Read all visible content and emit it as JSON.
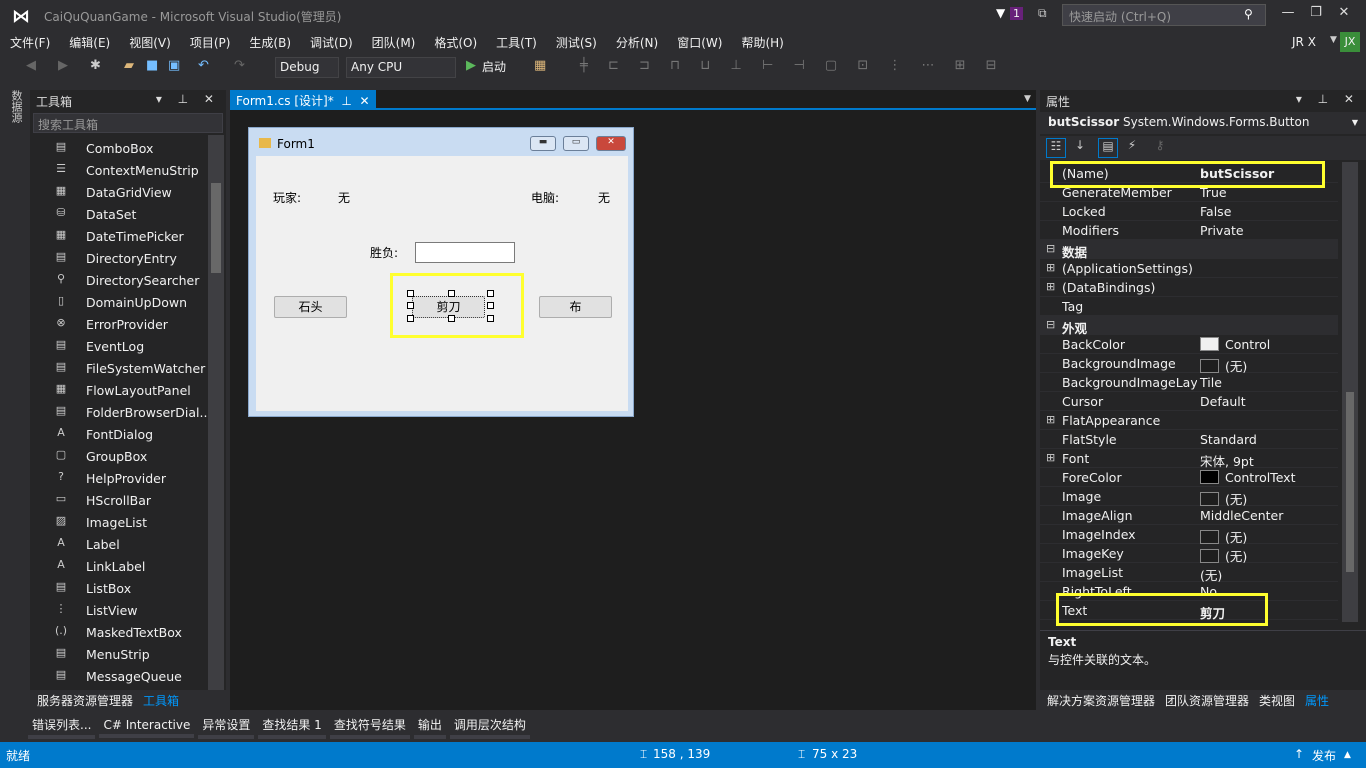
{
  "window": {
    "title": "CaiQuQuanGame - Microsoft Visual Studio(管理员)",
    "notif_count": "1",
    "quick_launch_placeholder": "快速启动 (Ctrl+Q)",
    "user": "JR X",
    "user_initials": "JX"
  },
  "menu": [
    "文件(F)",
    "编辑(E)",
    "视图(V)",
    "项目(P)",
    "生成(B)",
    "调试(D)",
    "团队(M)",
    "格式(O)",
    "工具(T)",
    "测试(S)",
    "分析(N)",
    "窗口(W)",
    "帮助(H)"
  ],
  "toolbar": {
    "config": "Debug",
    "platform": "Any CPU",
    "start": "启动"
  },
  "left_strip": "数据源",
  "toolbox": {
    "title": "工具箱",
    "search_placeholder": "搜索工具箱",
    "items": [
      "ComboBox",
      "ContextMenuStrip",
      "DataGridView",
      "DataSet",
      "DateTimePicker",
      "DirectoryEntry",
      "DirectorySearcher",
      "DomainUpDown",
      "ErrorProvider",
      "EventLog",
      "FileSystemWatcher",
      "FlowLayoutPanel",
      "FolderBrowserDial...",
      "FontDialog",
      "GroupBox",
      "HelpProvider",
      "HScrollBar",
      "ImageList",
      "Label",
      "LinkLabel",
      "ListBox",
      "ListView",
      "MaskedTextBox",
      "MenuStrip",
      "MessageQueue"
    ]
  },
  "document_tab": "Form1.cs [设计]*",
  "form": {
    "title": "Form1",
    "player_label": "玩家:",
    "player_value": "无",
    "computer_label": "电脑:",
    "computer_value": "无",
    "result_label": "胜负:",
    "result_value": "",
    "btn_rock": "石头",
    "btn_scissor": "剪刀",
    "btn_paper": "布"
  },
  "properties": {
    "title": "属性",
    "object_name": "butScissor",
    "object_type": "System.Windows.Forms.Button",
    "rows": [
      {
        "name": "(Name)",
        "value": "butScissor",
        "bold": true
      },
      {
        "name": "GenerateMember",
        "value": "True"
      },
      {
        "name": "Locked",
        "value": "False"
      },
      {
        "name": "Modifiers",
        "value": "Private"
      },
      {
        "name": "数据",
        "category": true,
        "expander": "⊟"
      },
      {
        "name": "(ApplicationSettings)",
        "value": "",
        "expander": "⊞"
      },
      {
        "name": "(DataBindings)",
        "value": "",
        "expander": "⊞"
      },
      {
        "name": "Tag",
        "value": ""
      },
      {
        "name": "外观",
        "category": true,
        "expander": "⊟"
      },
      {
        "name": "BackColor",
        "value": "Control",
        "swatch": "#f0f0f0"
      },
      {
        "name": "BackgroundImage",
        "value": "(无)",
        "swatch": "#1e1e1e"
      },
      {
        "name": "BackgroundImageLayout",
        "value": "Tile"
      },
      {
        "name": "Cursor",
        "value": "Default"
      },
      {
        "name": "FlatAppearance",
        "value": "",
        "expander": "⊞"
      },
      {
        "name": "FlatStyle",
        "value": "Standard"
      },
      {
        "name": "Font",
        "value": "宋体, 9pt",
        "expander": "⊞"
      },
      {
        "name": "ForeColor",
        "value": "ControlText",
        "swatch": "#000000"
      },
      {
        "name": "Image",
        "value": "(无)",
        "swatch": "#1e1e1e"
      },
      {
        "name": "ImageAlign",
        "value": "MiddleCenter"
      },
      {
        "name": "ImageIndex",
        "value": "(无)",
        "swatch": "#1e1e1e"
      },
      {
        "name": "ImageKey",
        "value": "(无)",
        "swatch": "#1e1e1e"
      },
      {
        "name": "ImageList",
        "value": "(无)"
      },
      {
        "name": "RightToLeft",
        "value": "No"
      },
      {
        "name": "Text",
        "value": "剪刀",
        "bold": true
      }
    ],
    "desc_title": "Text",
    "desc_text": "与控件关联的文本。"
  },
  "left_bottom_tabs": [
    "服务器资源管理器",
    "工具箱"
  ],
  "right_bottom_tabs": [
    "解决方案资源管理器",
    "团队资源管理器",
    "类视图",
    "属性"
  ],
  "output_tabs": [
    "错误列表...",
    "C# Interactive",
    "异常设置",
    "查找结果 1",
    "查找符号结果",
    "输出",
    "调用层次结构"
  ],
  "status": {
    "text": "就绪",
    "position": "158 , 139",
    "size": "75 x 23",
    "publish": "发布"
  },
  "colors": {
    "accent": "#007acc",
    "highlight": "#ffff2e"
  }
}
